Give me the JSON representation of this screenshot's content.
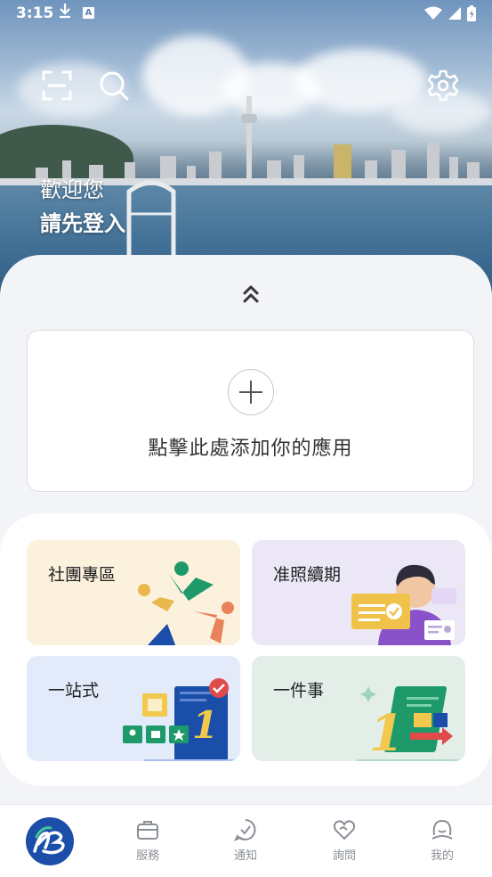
{
  "status_bar": {
    "time": "3:15",
    "download_icon": "download-icon",
    "app_badge": "A"
  },
  "header": {
    "welcome": "歡迎您",
    "login": "請先登入"
  },
  "add_app": {
    "label": "點擊此處添加你的應用"
  },
  "services": [
    {
      "label": "社團專區",
      "icon": "community-people-icon"
    },
    {
      "label": "准照續期",
      "icon": "license-renewal-icon"
    },
    {
      "label": "一站式",
      "icon": "one-stop-icon"
    },
    {
      "label": "一件事",
      "icon": "one-matter-icon"
    }
  ],
  "nav": {
    "items": [
      {
        "label": "服務",
        "icon": "briefcase-icon"
      },
      {
        "label": "通知",
        "icon": "chat-check-icon"
      },
      {
        "label": "詢問",
        "icon": "heart-hand-icon"
      },
      {
        "label": "我的",
        "icon": "profile-icon"
      }
    ]
  },
  "colors": {
    "brand": "#1b4ea8",
    "nav_text": "#8a8f96"
  }
}
